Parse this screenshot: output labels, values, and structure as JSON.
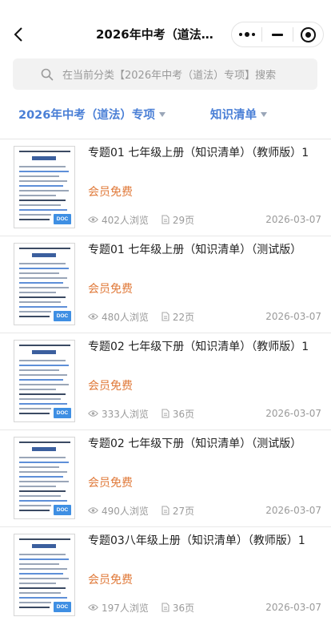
{
  "navbar": {
    "title": "2026年中考（道法）...",
    "icons": {
      "back": "chevron-left-icon",
      "more": "more-dots-icon",
      "minimize": "minus-icon",
      "close": "target-circle-icon"
    }
  },
  "search": {
    "placeholder": "在当前分类【2026年中考（道法）专项】搜索"
  },
  "filters": {
    "category_label": "2026年中考（道法）专项",
    "type_label": "知识清单"
  },
  "colors": {
    "accent": "#4a7fd6",
    "price": "#e07a3a",
    "meta": "#9a9a9a",
    "badge": "#3f8fe3"
  },
  "items": [
    {
      "title": "专题01 七年级上册（知识清单）（教师版）1",
      "price": "会员免费",
      "views": "402人浏览",
      "pages": "29页",
      "date": "2026-03-07",
      "badge": "DOC"
    },
    {
      "title": "专题01 七年级上册（知识清单）（测试版）",
      "price": "会员免费",
      "views": "480人浏览",
      "pages": "22页",
      "date": "2026-03-07",
      "badge": "DOC"
    },
    {
      "title": "专题02 七年级下册（知识清单）（教师版）1",
      "price": "会员免费",
      "views": "333人浏览",
      "pages": "36页",
      "date": "2026-03-07",
      "badge": "DOC"
    },
    {
      "title": "专题02 七年级下册（知识清单）（测试版）",
      "price": "会员免费",
      "views": "490人浏览",
      "pages": "27页",
      "date": "2026-03-07",
      "badge": "DOC"
    },
    {
      "title": "专题03八年级上册（知识清单）（教师版）1",
      "price": "会员免费",
      "views": "197人浏览",
      "pages": "36页",
      "date": "2026-03-07",
      "badge": "DOC"
    }
  ]
}
